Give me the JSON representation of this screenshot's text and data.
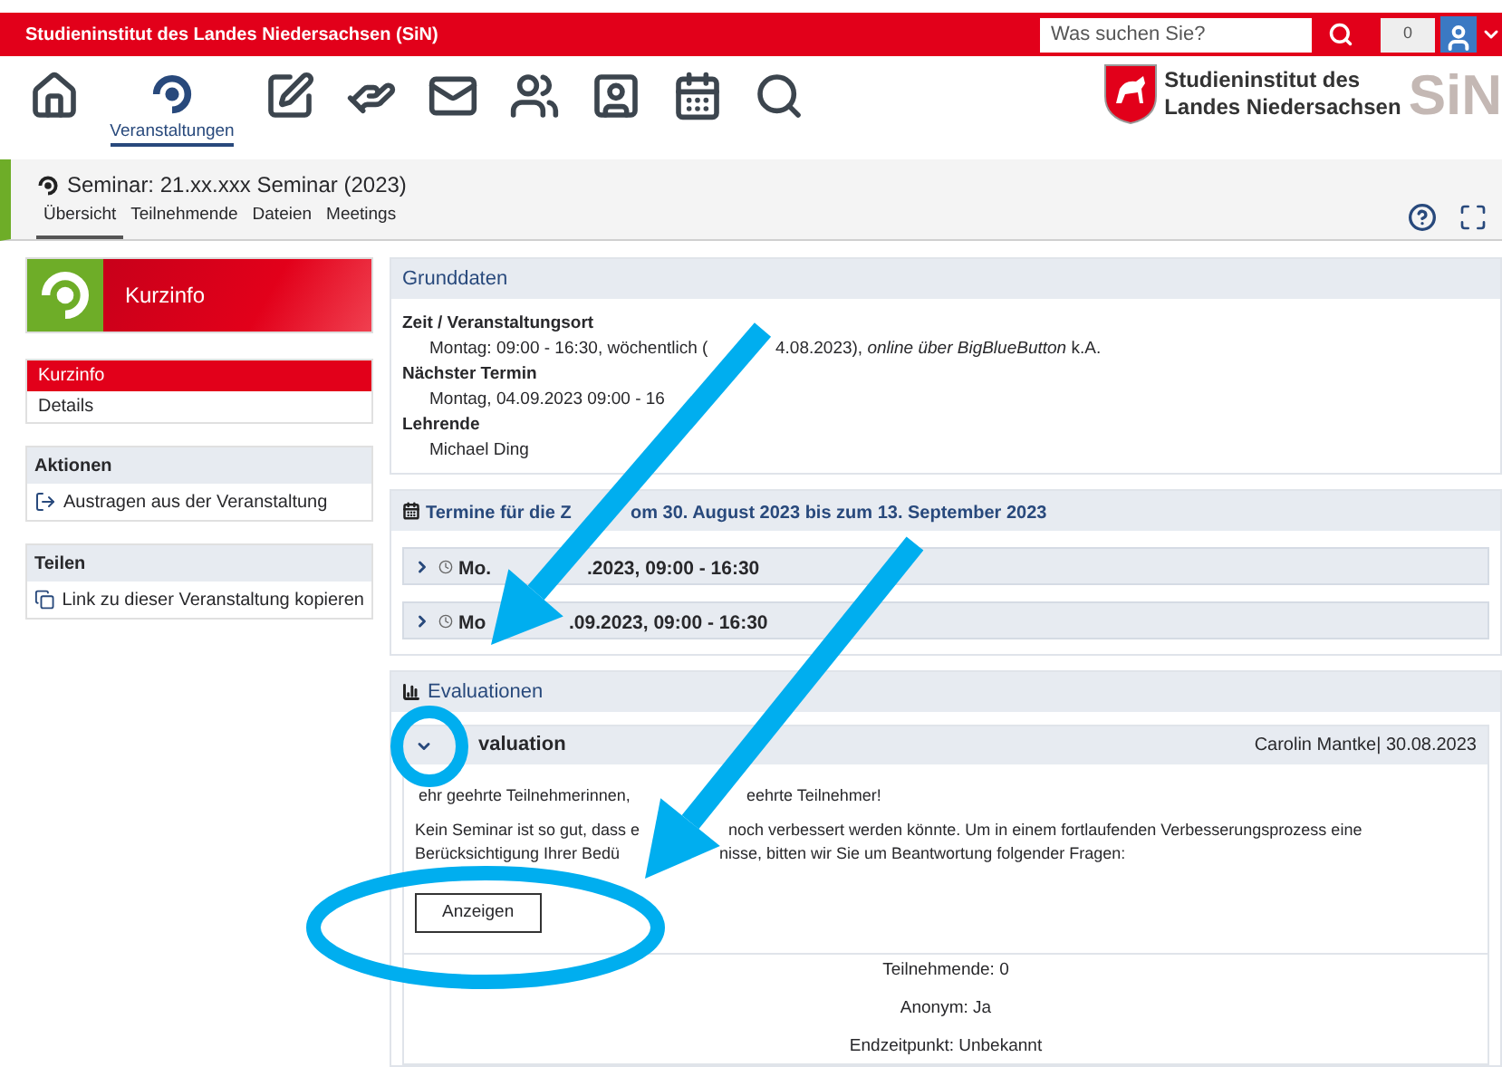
{
  "topbar": {
    "title": "Studieninstitut des Landes Niedersachsen (SiN)",
    "search": {
      "placeholder": "Was suchen Sie?"
    },
    "notifications": "0"
  },
  "nav": {
    "items": [
      {
        "kind": "home",
        "selected": false
      },
      {
        "kind": "courses",
        "selected": true,
        "label": "Veranstaltungen"
      },
      {
        "kind": "notes",
        "selected": false
      },
      {
        "kind": "hand",
        "selected": false
      },
      {
        "kind": "mail",
        "selected": false
      },
      {
        "kind": "people",
        "selected": false
      },
      {
        "kind": "profile",
        "selected": false
      },
      {
        "kind": "calendar",
        "selected": false
      },
      {
        "kind": "search",
        "selected": false
      }
    ],
    "logo": {
      "line1": "Studieninstitut des",
      "line2": "Landes Niedersachsen",
      "mark": "SiN"
    }
  },
  "context": {
    "title": "Seminar: 21.xx.xxx Seminar (2023)",
    "tabs": [
      {
        "label": "Übersicht",
        "selected": true
      },
      {
        "label": "Teilnehmende",
        "selected": false
      },
      {
        "label": "Dateien",
        "selected": false
      },
      {
        "label": "Meetings",
        "selected": false
      }
    ]
  },
  "sidebar": {
    "title": "Kurzinfo",
    "nav": [
      {
        "label": "Kurzinfo",
        "selected": true
      },
      {
        "label": "Details",
        "selected": false
      }
    ],
    "sections": [
      {
        "title": "Aktionen",
        "items": [
          {
            "kind": "leave",
            "label": "Austragen aus der Veranstaltung"
          }
        ]
      },
      {
        "title": "Teilen",
        "items": [
          {
            "kind": "copy",
            "label": "Link zu dieser Veranstaltung kopieren"
          }
        ]
      }
    ]
  },
  "grunddaten": {
    "title": "Grunddaten",
    "fields": [
      {
        "label": "Zeit / Veranstaltungsort",
        "value_parts": [
          "Montag: 09:00 - 16:30, wöchentlich (",
          "4.08.2023), *online über BigBlueButton* k.A."
        ]
      },
      {
        "label": "Nächster Termin",
        "value_parts": [
          "Montag, 04.09.2023 09:00 - 16"
        ]
      },
      {
        "label": "Lehrende",
        "value_parts": [
          "Michael Ding"
        ]
      }
    ]
  },
  "termine": {
    "title_parts": [
      "Termine für die Z",
      "om 30. August 2023 bis zum 13. September 2023"
    ],
    "rows": [
      {
        "expanded": false,
        "parts": [
          "Mo.",
          ".2023, 09:00 - 16:30"
        ]
      },
      {
        "expanded": false,
        "parts": [
          "Mo",
          ".09.2023, 09:00 - 16:30"
        ]
      }
    ]
  },
  "evaluationen": {
    "title": "Evaluationen",
    "item": {
      "expanded": true,
      "title": "valuation",
      "meta": "Carolin Mantke| 30.08.2023",
      "greeting_parts": [
        "ehr geehrte Teilnehmerinnen,",
        "eehrte Teilnehmer!"
      ],
      "text_parts": [
        "Kein Seminar ist so gut, dass e",
        "noch verbessert werden könnte. Um in einem fortlaufenden Verbesserungsprozess eine"
      ],
      "text2_parts": [
        "Berücksichtigung Ihrer Bedü",
        "nisse, bitten wir Sie um Beantwortung folgender Fragen:"
      ],
      "button": "Anzeigen",
      "stats": [
        "Teilnehmende: 0",
        "Anonym: Ja",
        "Endzeitpunkt: Unbekannt"
      ]
    }
  },
  "annotations": [
    {
      "kind": "arrow"
    },
    {
      "kind": "arrow"
    },
    {
      "kind": "ring"
    },
    {
      "kind": "ring"
    }
  ]
}
